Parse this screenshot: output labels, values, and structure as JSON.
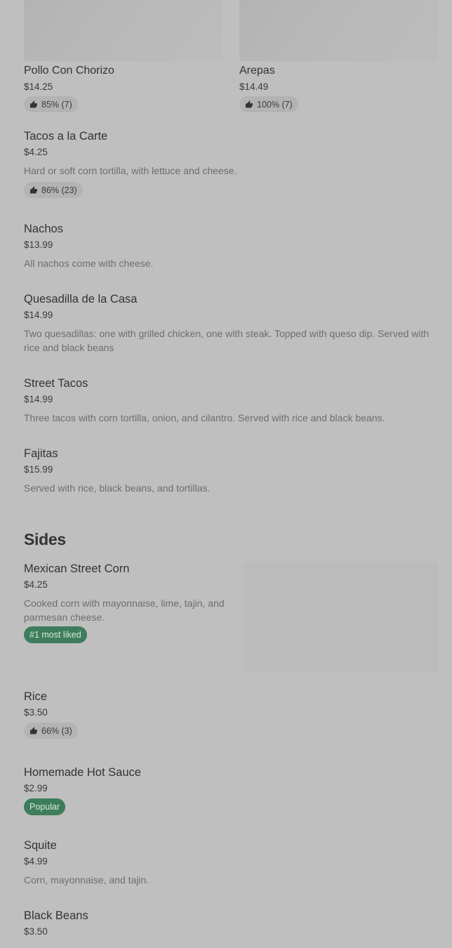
{
  "featured": [
    {
      "name": "Pollo Con Chorizo",
      "price": "$14.25",
      "rating": "85% (7)"
    },
    {
      "name": "Arepas",
      "price": "$14.49",
      "rating": "100% (7)"
    }
  ],
  "menu_items": [
    {
      "name": "Tacos a la Carte",
      "price": "$4.25",
      "description": "Hard or soft corn tortilla, with lettuce and cheese.",
      "rating": "86% (23)"
    },
    {
      "name": "Nachos",
      "price": "$13.99",
      "description": "All nachos come with cheese."
    },
    {
      "name": "Quesadilla de la Casa",
      "price": "$14.99",
      "description": "Two quesadillas: one with grilled chicken, one with steak. Topped with queso dip. Served with rice and black beans"
    },
    {
      "name": "Street Tacos",
      "price": "$14.99",
      "description": "Three tacos with corn tortilla, onion, and cilantro. Served with rice and black beans."
    },
    {
      "name": "Fajitas",
      "price": "$15.99",
      "description": "Served with rice, black beans, and tortillas."
    }
  ],
  "sides": {
    "title": "Sides",
    "items": [
      {
        "name": "Mexican Street Corn",
        "price": "$4.25",
        "description": "Cooked corn with mayonnaise, lime, tajin, and parmesan cheese.",
        "badge": "#1 most liked"
      },
      {
        "name": "Rice",
        "price": "$3.50",
        "rating": "66% (3)"
      },
      {
        "name": "Homemade Hot Sauce",
        "price": "$2.99",
        "badge": "Popular"
      },
      {
        "name": "Squite",
        "price": "$4.99",
        "description": "Corn, mayonnaise, and tajin."
      },
      {
        "name": "Black Beans",
        "price": "$3.50"
      }
    ]
  },
  "colors": {
    "background": "#bfbfbf",
    "badge": "#3d7d5c"
  },
  "icons": {
    "rating": "thumbs-up-icon"
  }
}
